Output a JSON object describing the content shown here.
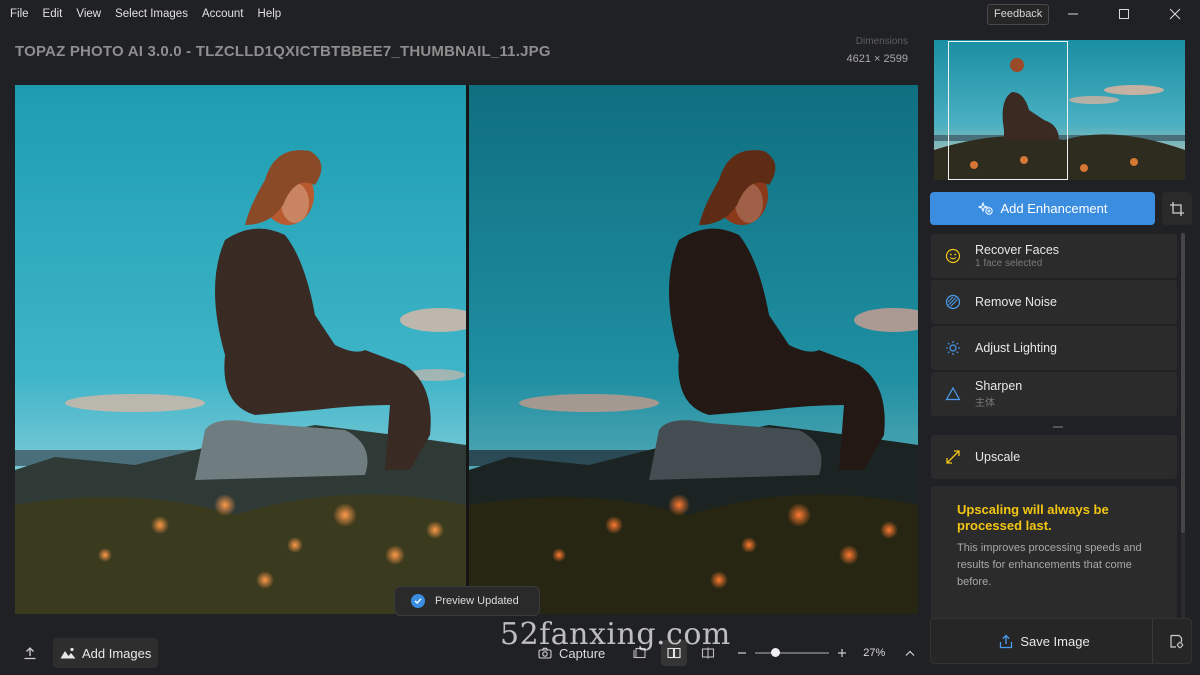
{
  "menu": [
    "File",
    "Edit",
    "View",
    "Select Images",
    "Account",
    "Help"
  ],
  "window": {
    "feedback_label": "Feedback"
  },
  "header": {
    "title": "TOPAZ PHOTO AI 3.0.0 - TLZCLLD1QXICTBTBBEE7_THUMBNAIL_11.JPG",
    "dimensions_label": "Dimensions",
    "dimensions_value": "4621 × 2599"
  },
  "toast": {
    "text": "Preview Updated"
  },
  "bottom": {
    "add_images_label": "Add Images",
    "capture_label": "Capture",
    "zoom_percent": "27%",
    "zoom_level": 0.27
  },
  "watermark": "52fanxing.com",
  "sidebar": {
    "add_enhancement_label": "Add Enhancement",
    "enhancements": [
      {
        "label": "Recover Faces",
        "sub": "1 face selected",
        "icon": "smiley-icon"
      },
      {
        "label": "Remove Noise",
        "sub": "",
        "icon": "noise-icon"
      },
      {
        "label": "Adjust Lighting",
        "sub": "",
        "icon": "sun-icon"
      },
      {
        "label": "Sharpen",
        "sub": "主体",
        "icon": "triangle-icon"
      }
    ],
    "upscale_label": "Upscale",
    "upscale_note": {
      "title": "Upscaling will always be processed last.",
      "body": "This improves processing speeds and results for enhancements that come before."
    },
    "save_label": "Save Image"
  },
  "colors": {
    "accent": "#3b8de0",
    "warning": "#f3c613",
    "background": "#202124",
    "panel": "#2b2b2b"
  }
}
